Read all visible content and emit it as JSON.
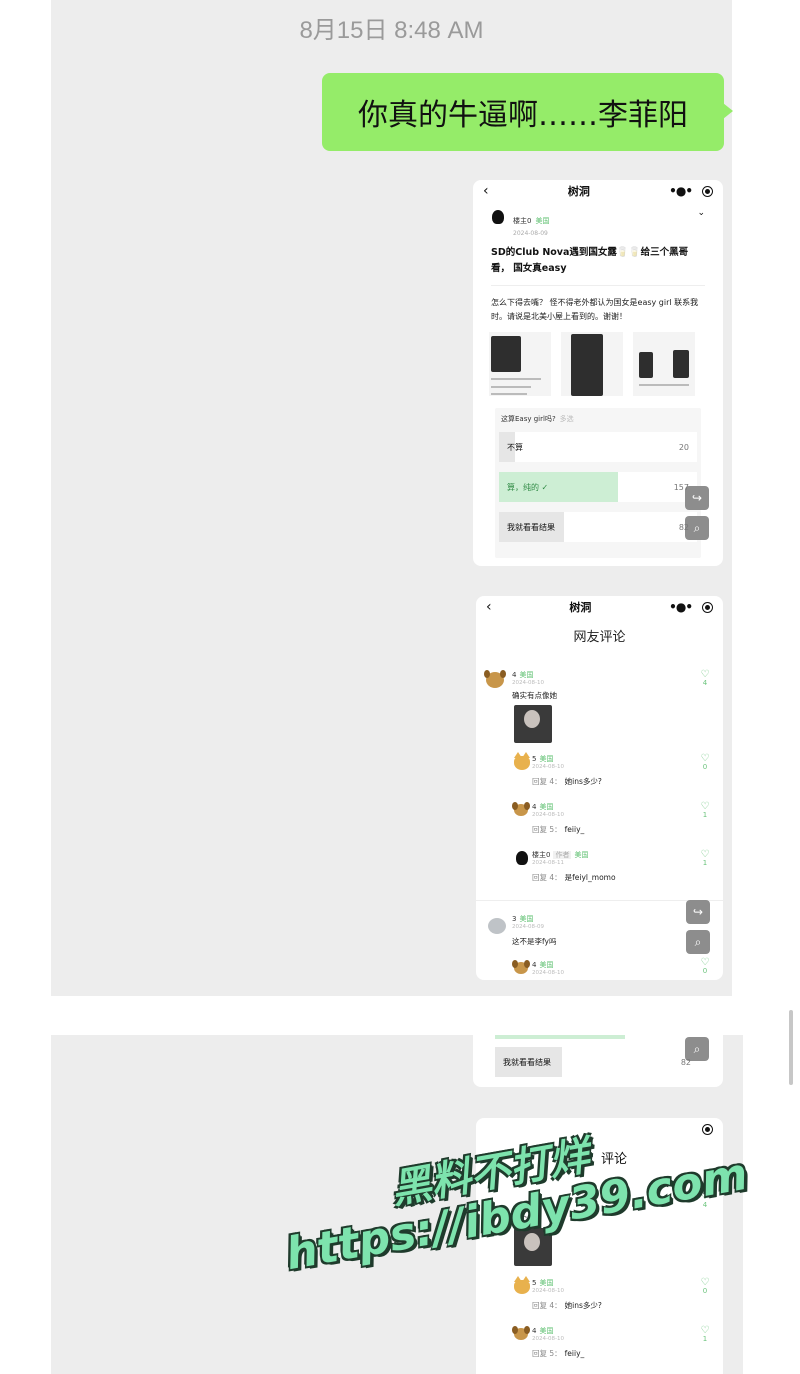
{
  "chat": {
    "timestamp": "8月15日 8:48 AM",
    "message": "你真的牛逼啊……李菲阳"
  },
  "shared_post": {
    "app_title": "树洞",
    "author": "楼主0",
    "author_location": "美国",
    "date": "2024-08-09",
    "title": "SD的Club Nova遇到国女露🥛🥛给三个黑哥看， 国女真easy",
    "body": "怎么下得去嘴？ 怪不得老外都认为国女是easy girl 联系我时。请说是北美小屋上看到的。谢谢！",
    "poll": {
      "question": "这算Easy girl吗?",
      "mode": "多选",
      "options": [
        {
          "label": "不算",
          "count": "20",
          "fraction": 0.08,
          "selected": false
        },
        {
          "label": "算，纯的 ✓",
          "count": "157",
          "fraction": 0.6,
          "selected": true
        },
        {
          "label": "我就看看结果",
          "count": "82",
          "fraction": 0.33,
          "selected": false
        }
      ]
    }
  },
  "comments_card": {
    "app_title": "树洞",
    "heading": "网友评论",
    "comments": [
      {
        "name": "4",
        "location": "美国",
        "date": "2024-08-10",
        "text": "确实有点像她",
        "likes": "4",
        "avatar": "dog-avatar"
      },
      {
        "name": "5",
        "location": "美国",
        "date": "2024-08-10",
        "reply_to": "回复 4：",
        "text": "她ins多少?",
        "likes": "0",
        "avatar": "cat-avatar"
      },
      {
        "name": "4",
        "location": "美国",
        "date": "2024-08-10",
        "reply_to": "回复 5：",
        "text": "feiiy_",
        "likes": "1",
        "avatar": "dog-avatar"
      },
      {
        "name": "楼主0",
        "role": "作者",
        "location": "美国",
        "date": "2024-08-11",
        "reply_to": "回复 4：",
        "text": "是feiyl_momo",
        "likes": "1",
        "avatar": "bird-avatar"
      },
      {
        "name": "3",
        "location": "美国",
        "date": "2024-08-09",
        "text": "这不是李fy吗",
        "likes": "0",
        "avatar": "koala-avatar"
      },
      {
        "name": "4",
        "location": "美国",
        "date": "2024-08-10",
        "likes": "0",
        "avatar": "dog-avatar"
      }
    ]
  },
  "second_screenshot": {
    "poll_option": "我就看看结果",
    "poll_count": "82",
    "comments": [
      {
        "name": "5",
        "location": "美国",
        "date": "2024-08-10",
        "reply_to": "回复 4：",
        "text": "她ins多少?",
        "likes": "0"
      },
      {
        "name": "4",
        "location": "美国",
        "date": "2024-08-10",
        "reply_to": "回复 5：",
        "text": "feiiy_",
        "likes": "1"
      }
    ],
    "partial_text_1": "确实有",
    "partial_text_2": "她",
    "partial_likes": "4",
    "partial_heading": "评论"
  },
  "watermark": {
    "line1": "黑料不打烊",
    "line2": "https://ibdy39.com"
  }
}
